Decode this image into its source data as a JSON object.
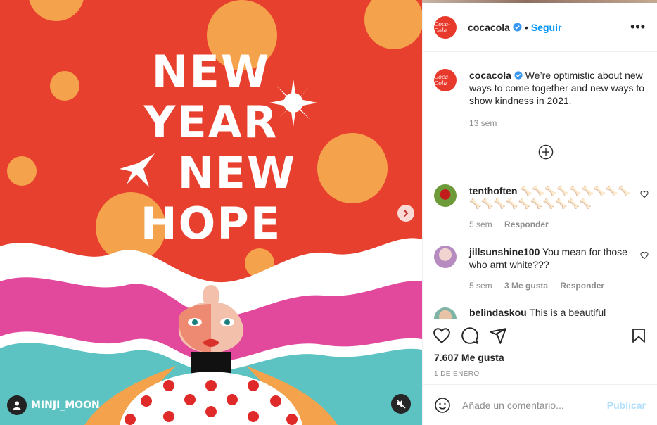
{
  "post": {
    "headline": [
      "NEW",
      "YEAR",
      "NEW",
      "HOPE"
    ],
    "credit": "MINJI_MOON"
  },
  "header": {
    "username": "cocacola",
    "separator": "•",
    "follow_label": "Seguir",
    "more_label": "•••"
  },
  "caption": {
    "username": "cocacola",
    "text": "We’re optimistic about new ways to come together and new ways to show kindness in 2021.",
    "time": "13 sem"
  },
  "comments": [
    {
      "username": "tenthoften",
      "text": "🦴🦴🦴🦴🦴🦴🦴🦴🦴🦴🦴🦴🦴🦴🦴🦴🦴🦴🦴",
      "time": "5 sem",
      "likes": "",
      "reply": "Responder"
    },
    {
      "username": "jillsunshine100",
      "text": "You mean for those who arnt white???",
      "time": "5 sem",
      "likes": "3 Me gusta",
      "reply": "Responder"
    },
    {
      "username": "belindaskou",
      "text": "This is a beautiful"
    }
  ],
  "footer": {
    "likes": "7.607 Me gusta",
    "date": "1 DE ENERO",
    "comment_placeholder": "Añade un comentario...",
    "publish_label": "Publicar"
  },
  "colors": {
    "brand_red": "#e8392d",
    "link_blue": "#0095f6",
    "publish_disabled": "#b2dffc"
  },
  "icons": {
    "like": "heart-icon",
    "comment": "speech-bubble-icon",
    "share": "paper-plane-icon",
    "save": "bookmark-icon",
    "emoji": "smiley-icon",
    "mute": "speaker-muted-icon",
    "tag": "user-tag-icon",
    "next": "chevron-right-icon",
    "verified": "verified-badge-icon",
    "load_more": "plus-circle-icon"
  }
}
